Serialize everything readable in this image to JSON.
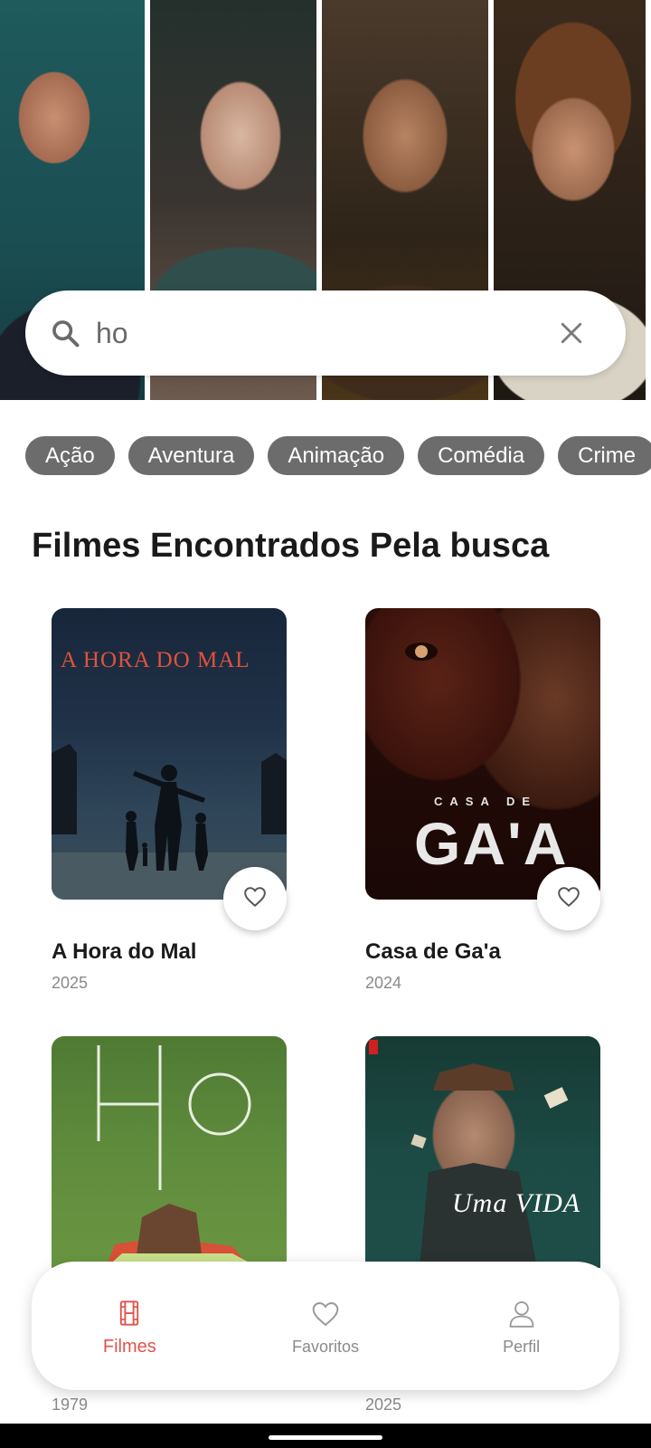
{
  "search": {
    "value": "ho"
  },
  "genres": [
    "Ação",
    "Aventura",
    "Animação",
    "Comédia",
    "Crime"
  ],
  "section_title": "Filmes Encontrados Pela busca",
  "movies": [
    {
      "title": "A Hora do Mal",
      "year": "2025",
      "poster_text": "A HORA DO MAL"
    },
    {
      "title": "Casa de Ga'a",
      "year": "2024",
      "poster_text": "GA'A",
      "poster_subtext": "CASA DE"
    },
    {
      "year": "1979",
      "poster_text": "HO"
    },
    {
      "year": "2025",
      "poster_text": "Uma VIDA"
    }
  ],
  "nav": {
    "items": [
      {
        "label": "Filmes",
        "icon": "film-icon",
        "active": true
      },
      {
        "label": "Favoritos",
        "icon": "heart-icon",
        "active": false
      },
      {
        "label": "Perfil",
        "icon": "person-icon",
        "active": false
      }
    ]
  },
  "colors": {
    "accent": "#e0524a",
    "chip_bg": "#6c6c6c"
  }
}
